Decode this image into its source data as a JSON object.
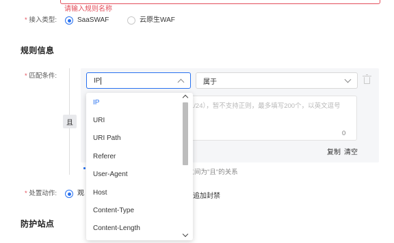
{
  "rule_name": {
    "error": "请输入规则名称"
  },
  "access_type": {
    "label": "接入类型:",
    "options": [
      {
        "label": "SaaSWAF",
        "checked": true
      },
      {
        "label": "云原生WAF",
        "checked": false
      }
    ]
  },
  "rule_info": {
    "title": "规则信息"
  },
  "match": {
    "label": "匹配条件:",
    "and_label": "且",
    "field_value": "IP",
    "operator_value": "属于",
    "textarea_placeholder": "1/24），暂不支持正则，最多填写200个，以英文逗号",
    "textarea_count": "0",
    "copy_label": "复制",
    "clear_label": "清空",
    "relation_hint": "件之间为\"且\"的关系",
    "field_options": [
      "IP",
      "URI",
      "URI Path",
      "Referer",
      "User-Agent",
      "Host",
      "Content-Type",
      "Content-Length"
    ],
    "selected_option": "IP"
  },
  "action": {
    "label": "处置动作:",
    "option_partial": "观",
    "option2_partial": "追加封禁"
  },
  "protect_sites": {
    "title": "防护站点"
  },
  "icons": {
    "field_chevron": "chevron-up-icon",
    "operator_chevron": "chevron-down-icon",
    "delete": "trash-icon"
  },
  "colors": {
    "primary": "#2670f0",
    "error": "#e34d59"
  }
}
